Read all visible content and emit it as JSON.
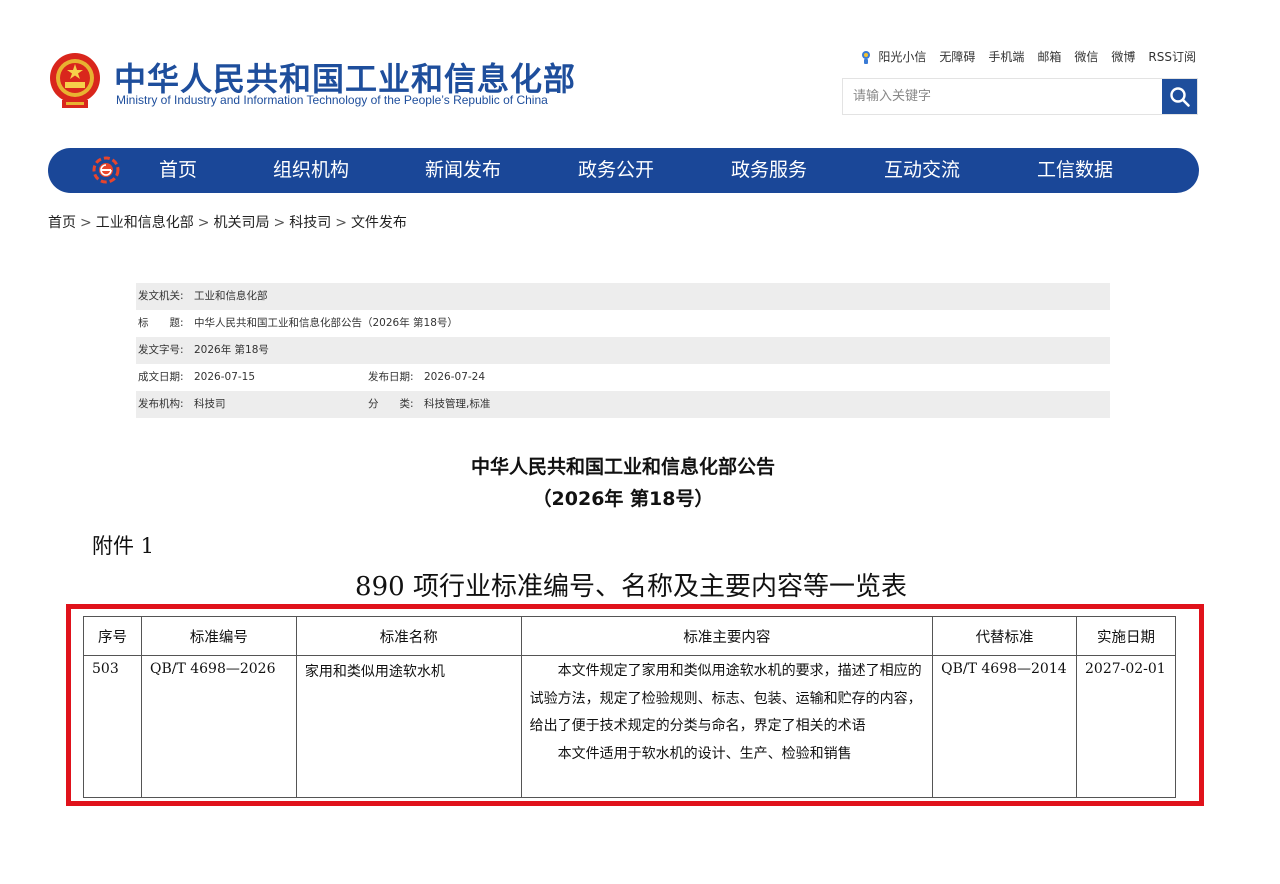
{
  "header": {
    "title_cn": "中华人民共和国工业和信息化部",
    "title_en": "Ministry of Industry and Information Technology of the People’s Republic of China",
    "toplinks": [
      "阳光小信",
      "无障碍",
      "手机端",
      "邮箱",
      "微信",
      "微博",
      "RSS订阅"
    ],
    "search_placeholder": "请输入关键字"
  },
  "nav": {
    "items": [
      "首页",
      "组织机构",
      "新闻发布",
      "政务公开",
      "政务服务",
      "互动交流",
      "工信数据"
    ]
  },
  "breadcrumb": [
    "首页",
    "工业和信息化部",
    "机关司局",
    "科技司",
    "文件发布"
  ],
  "meta": {
    "issuer_label": "发文机关:",
    "issuer": "工业和信息化部",
    "title_label": "标　　题:",
    "title": "中华人民共和国工业和信息化部公告（2026年 第18号）",
    "doc_no_label": "发文字号:",
    "doc_no": "2026年 第18号",
    "written_date_label": "成文日期:",
    "written_date": "2026-07-15",
    "publish_date_label": "发布日期:",
    "publish_date": "2026-07-24",
    "org_label": "发布机构:",
    "org": "科技司",
    "category_label": "分　　类:",
    "category": "科技管理,标准"
  },
  "document": {
    "title_line1": "中华人民共和国工业和信息化部公告",
    "title_line2": "（2026年 第18号）",
    "attachment_label": "附件 1",
    "list_title": "890 项行业标准编号、名称及主要内容等一览表"
  },
  "standards_table": {
    "headers": [
      "序号",
      "标准编号",
      "标准名称",
      "标准主要内容",
      "代替标准",
      "实施日期"
    ],
    "row": {
      "seq": "503",
      "code": "QB/T 4698—2026",
      "name": "家用和类似用途软水机",
      "content_p1": "本文件规定了家用和类似用途软水机的要求，描述了相应的试验方法，规定了检验规则、标志、包装、运输和贮存的内容，给出了便于技术规定的分类与命名，界定了相关的术语",
      "content_p2": "本文件适用于软水机的设计、生产、检验和销售",
      "replaces": "QB/T 4698—2014",
      "effective_date": "2027-02-01"
    }
  },
  "colors": {
    "brand_blue": "#1a4798",
    "highlight_red": "#e0121b",
    "meta_shade": "#ededed"
  }
}
